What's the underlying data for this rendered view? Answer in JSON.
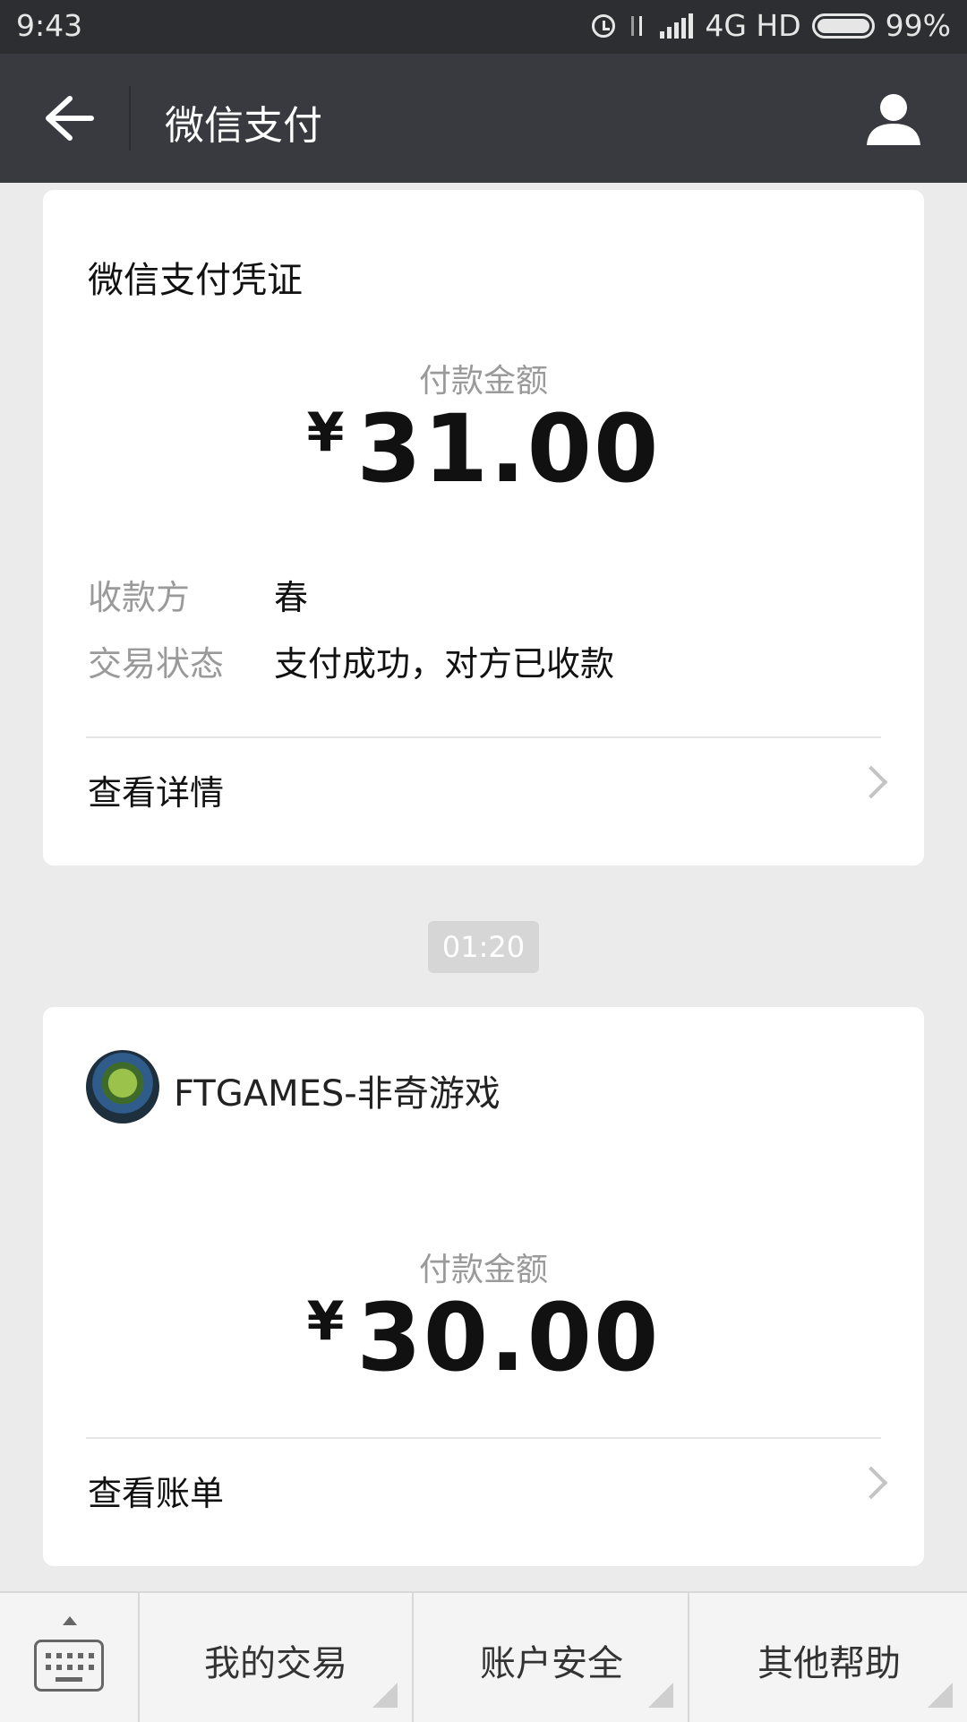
{
  "status_bar": {
    "time": "9:43",
    "network": "4G HD",
    "battery": "99%"
  },
  "header": {
    "title": "微信支付"
  },
  "receipt_card": {
    "title": "微信支付凭证",
    "amount_label": "付款金额",
    "currency": "¥",
    "amount": "31.00",
    "rows": [
      {
        "key": "收款方",
        "value": "春"
      },
      {
        "key": "交易状态",
        "value": "支付成功，对方已收款"
      }
    ],
    "link_label": "查看详情"
  },
  "timestamp": "01:20",
  "bill_card": {
    "account_name": "FTGAMES-非奇游戏",
    "amount_label": "付款金额",
    "currency": "¥",
    "amount": "30.00",
    "link_label": "查看账单"
  },
  "bottom_menu": {
    "items": [
      {
        "label": "我的交易"
      },
      {
        "label": "账户安全"
      },
      {
        "label": "其他帮助"
      }
    ]
  }
}
